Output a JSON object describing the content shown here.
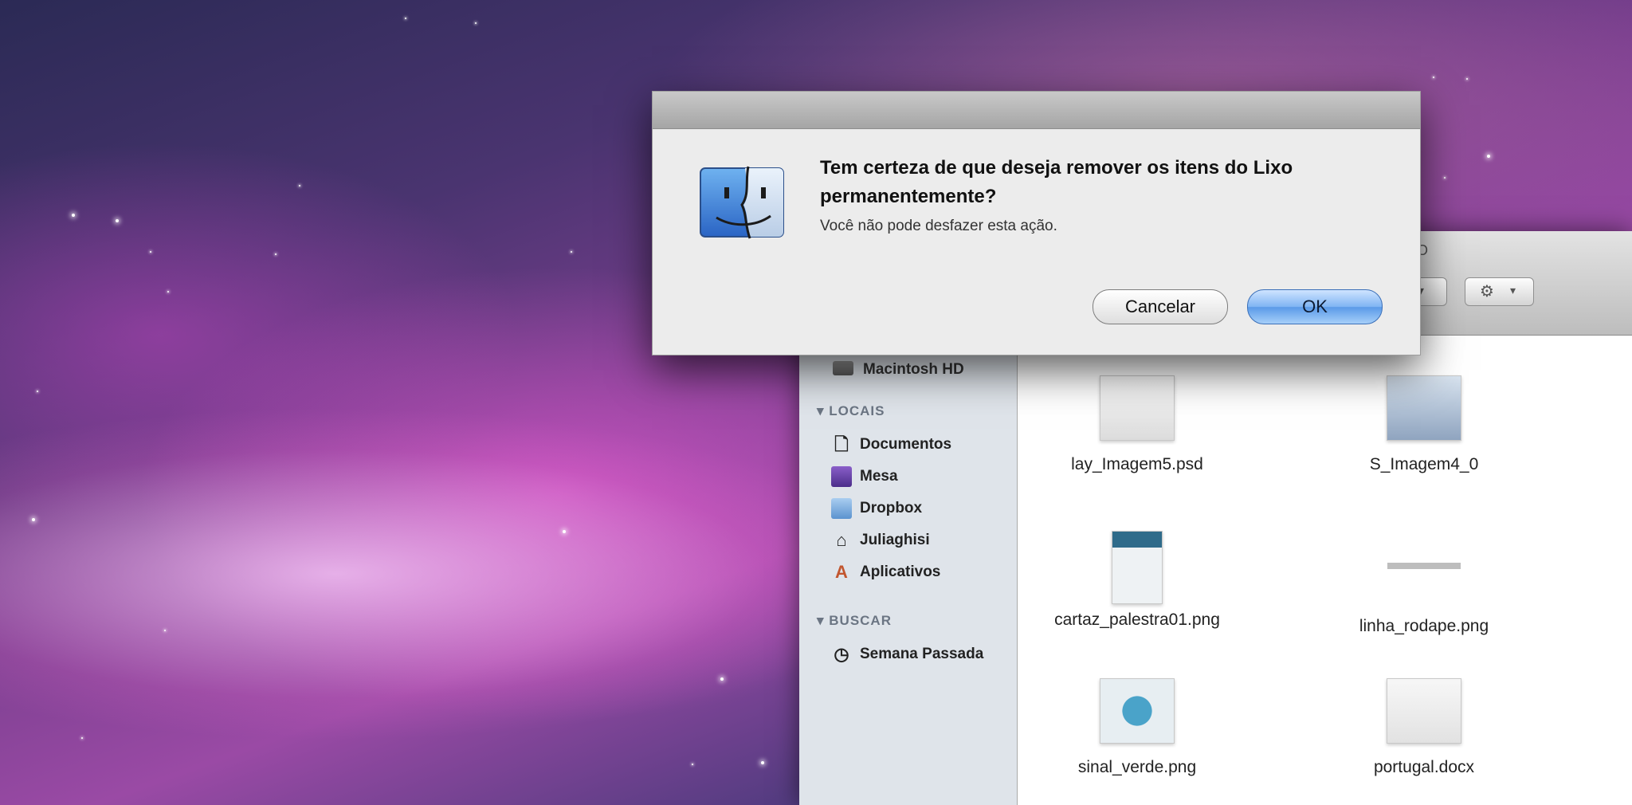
{
  "alert": {
    "title": "Tem certeza de que deseja remover os itens do Lixo permanentemente?",
    "message": "Você não pode desfazer esta ação.",
    "cancel_label": "Cancelar",
    "ok_label": "OK",
    "icon": "finder-face-icon"
  },
  "finder": {
    "title_fragment": "IO",
    "sidebar": {
      "device_label": "Macintosh HD",
      "locais_header": "LOCAIS",
      "locais_items": [
        {
          "label": "Documentos",
          "icon": "document-icon"
        },
        {
          "label": "Mesa",
          "icon": "desktop-icon"
        },
        {
          "label": "Dropbox",
          "icon": "folder-icon"
        },
        {
          "label": "Juliaghisi",
          "icon": "home-icon"
        },
        {
          "label": "Aplicativos",
          "icon": "applications-icon"
        }
      ],
      "buscar_header": "BUSCAR",
      "buscar_items": [
        {
          "label": "Semana Passada",
          "icon": "clock-icon"
        }
      ]
    },
    "files": [
      {
        "label": "lay_Imagem5.psd"
      },
      {
        "label": "S_Imagem4_0"
      },
      {
        "label": "cartaz_palestra01.png"
      },
      {
        "label": "linha_rodape.png"
      },
      {
        "label": "sinal_verde.png"
      },
      {
        "label": "portugal.docx"
      }
    ]
  }
}
